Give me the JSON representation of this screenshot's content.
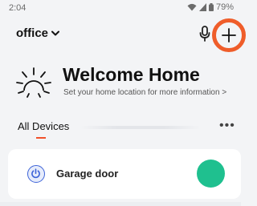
{
  "status_bar": {
    "time": "2:04",
    "battery": "79%",
    "icons": [
      "wifi-icon",
      "signal-icon",
      "battery-icon"
    ]
  },
  "header": {
    "home_name": "office",
    "home_dropdown_icon": "chevron-down-icon",
    "mic_icon": "microphone-icon",
    "add_icon": "plus-icon",
    "highlight_color": "#ef5d2a"
  },
  "welcome": {
    "icon": "sun-icon",
    "title": "Welcome Home",
    "subtitle": "Set your home location for more information >"
  },
  "tabs": {
    "active_label": "All Devices",
    "accent_color": "#f1502a",
    "more_label": "•••"
  },
  "devices": [
    {
      "name": "Garage door",
      "icon": "power-icon",
      "toggle_color": "#1fc08f"
    }
  ]
}
